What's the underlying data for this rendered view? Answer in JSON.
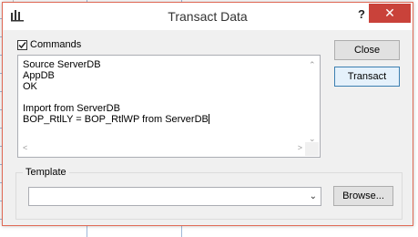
{
  "window": {
    "title": "Transact Data",
    "help_label": "?",
    "close_glyph": "✕"
  },
  "commands": {
    "checkbox_label": "Commands",
    "checked": true,
    "lines": [
      "Source ServerDB",
      "AppDB",
      "OK",
      "",
      "Import from ServerDB",
      "BOP_RtlLY = BOP_RtlWP from ServerDB"
    ]
  },
  "buttons": {
    "close_label": "Close",
    "transact_label": "Transact",
    "browse_label": "Browse..."
  },
  "template": {
    "group_label": "Template",
    "value": ""
  },
  "colors": {
    "close_button_bg": "#c9423a",
    "window_border": "#e06a56",
    "focus_border": "#3c7fb1"
  }
}
